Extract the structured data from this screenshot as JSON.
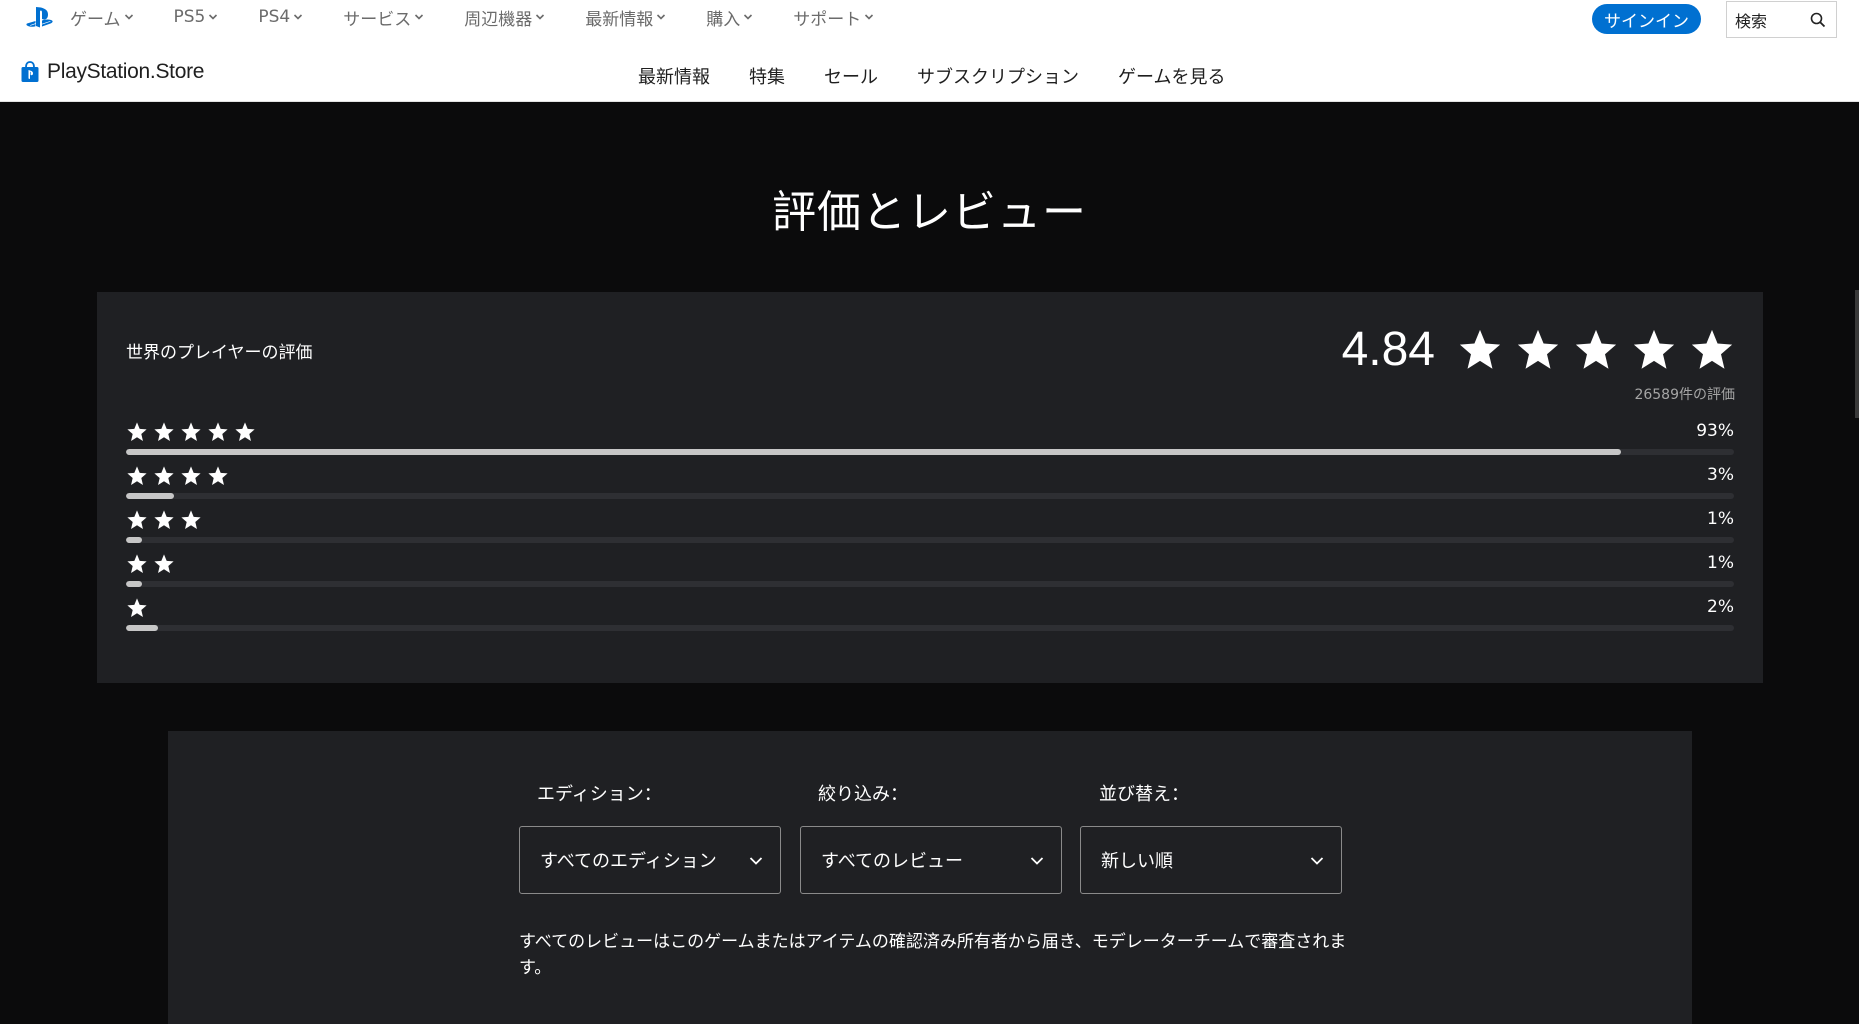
{
  "global_nav": {
    "items": [
      "ゲーム",
      "PS5",
      "PS4",
      "サービス",
      "周辺機器",
      "最新情報",
      "購入",
      "サポート"
    ],
    "signin_label": "サインイン",
    "search_label": "検索"
  },
  "store_bar": {
    "brand": "PlayStation.Store",
    "items": [
      "最新情報",
      "特集",
      "セール",
      "サブスクリプション",
      "ゲームを見る"
    ]
  },
  "reviews": {
    "title": "評価とレビュー",
    "ratings_label": "世界のプレイヤーの評価",
    "average": "4.84",
    "average_stars": 5,
    "count_text": "26589件の評価",
    "distribution": [
      {
        "stars": 5,
        "percent_label": "93%",
        "fraction": 0.93
      },
      {
        "stars": 4,
        "percent_label": "3%",
        "fraction": 0.03
      },
      {
        "stars": 3,
        "percent_label": "1%",
        "fraction": 0.01
      },
      {
        "stars": 2,
        "percent_label": "1%",
        "fraction": 0.01
      },
      {
        "stars": 1,
        "percent_label": "2%",
        "fraction": 0.02
      }
    ]
  },
  "filters": {
    "edition_label": "エディション：",
    "edition_value": "すべてのエディション",
    "filter_label": "絞り込み：",
    "filter_value": "すべてのレビュー",
    "sort_label": "並び替え：",
    "sort_value": "新しい順",
    "notice": "すべてのレビューはこのゲームまたはアイテムの確認済み所有者から届き、モデレーターチームで審査されます。"
  },
  "colors": {
    "accent": "#0070d1",
    "panel": "#1f2023",
    "page_bg": "#0b0b0c",
    "bar_fill": "#c6c6c6",
    "bar_track": "#2e2f33"
  }
}
